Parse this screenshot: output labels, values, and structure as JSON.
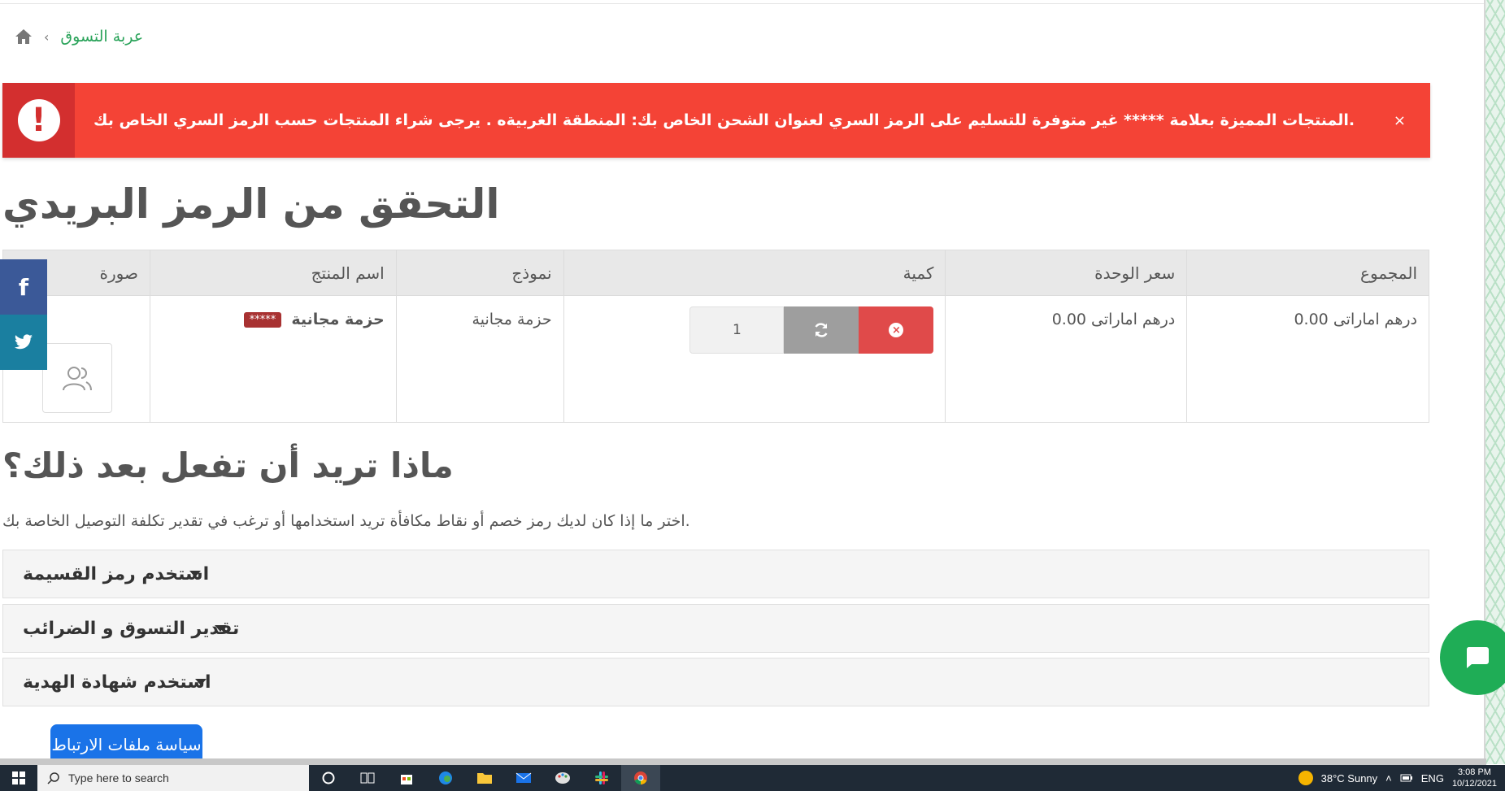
{
  "breadcrumb": {
    "current": "عربة التسوق"
  },
  "alert": {
    "message": ".المنتجات المميزة بعلامة ***** غير متوفرة للتسليم على الرمز السري لعنوان الشحن الخاص بك: المنطقة الغربيةه . يرجى شراء المنتجات حسب الرمز السري الخاص بك",
    "close": "×"
  },
  "page_title": "التحقق من الرمز البريدي",
  "cart_table": {
    "headers": {
      "total": "المجموع",
      "unit_price": "سعر الوحدة",
      "quantity": "كمية",
      "model": "نموذج",
      "product_name": "اسم المنتج",
      "image": "صورة"
    },
    "rows": [
      {
        "total": "درهم اماراتى 0.00",
        "unit_price": "درهم اماراتى 0.00",
        "quantity": "1",
        "model": "حزمة مجانية",
        "product_name": "حزمة مجانية",
        "badge": "*****"
      }
    ]
  },
  "social": {
    "facebook": "f",
    "twitter": "twitter-icon"
  },
  "next_section": {
    "title": "ماذا تريد أن تفعل بعد ذلك؟",
    "hint": ".اختر ما إذا كان لديك رمز خصم أو نقاط مكافأة تريد استخدامها أو ترغب في تقدير تكلفة التوصيل الخاصة بك",
    "accordions": [
      "استخدم رمز القسيمة",
      "تقدير التسوق و الضرائب",
      "استخدم شهادة الهدية"
    ]
  },
  "cookie_button": "سياسة ملفات الارتباط",
  "taskbar": {
    "search_placeholder": "Type here to search",
    "weather": "38°C  Sunny",
    "lang": "ENG",
    "time": "3:08 PM",
    "date": "10/12/2021"
  },
  "colors": {
    "alert": "#f44336",
    "accent_green": "#2aa35a",
    "chat": "#1fad56",
    "cookie": "#1a73e8"
  }
}
